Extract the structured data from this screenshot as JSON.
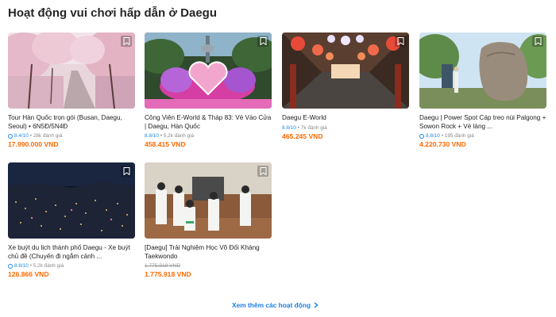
{
  "section": {
    "title": "Hoạt động vui chơi hấp dẫn ở Daegu"
  },
  "colors": {
    "price": "#ff6a00",
    "rating": "#1e88e5",
    "link": "#1e7fe0"
  },
  "cards": [
    {
      "title": "Tour Hàn Quốc trọn gói (Busan, Daegu, Seoul) • 6N5Đ/5N4Đ",
      "score": "8.4/10",
      "reviews": "• 28k đánh giá",
      "price": "17.990.000 VND",
      "image": "cherry-blossom-road"
    },
    {
      "title": "Công Viên E-World & Tháp 83: Vé Vào Cửa | Daegu, Hàn Quốc",
      "score": "8.8/10",
      "reviews": "• 5,2k đánh giá",
      "price": "458.415 VND",
      "image": "e-world-tower-heart-sign"
    },
    {
      "title": "Daegu E-World",
      "score": "8.8/10",
      "reviews": "• 7k đánh giá",
      "price": "465.245 VND",
      "image": "lantern-street"
    },
    {
      "title": "Daegu | Power Spot Cáp treo núi Palgong + Sowon Rock + Vé làng ...",
      "score": "8.8/10",
      "reviews": "• 195 đánh giá",
      "price": "4.220.730 VND",
      "image": "sowon-rock"
    },
    {
      "title": "Xe buýt du lịch thành phố Daegu - Xe buýt chủ đề (Chuyến đi ngắm cảnh ...",
      "score": "8.8/10",
      "reviews": "• 5,2k đánh giá",
      "price": "126.866 VND",
      "image": "city-night-view"
    },
    {
      "title": "[Daegu] Trải Nghiệm Học Võ Đối Kháng Taekwondo",
      "old_price": "1.775.919 VND",
      "price": "1.775.918 VND",
      "image": "taekwondo-class"
    }
  ],
  "see_more": {
    "label": "Xem thêm các hoạt động"
  }
}
